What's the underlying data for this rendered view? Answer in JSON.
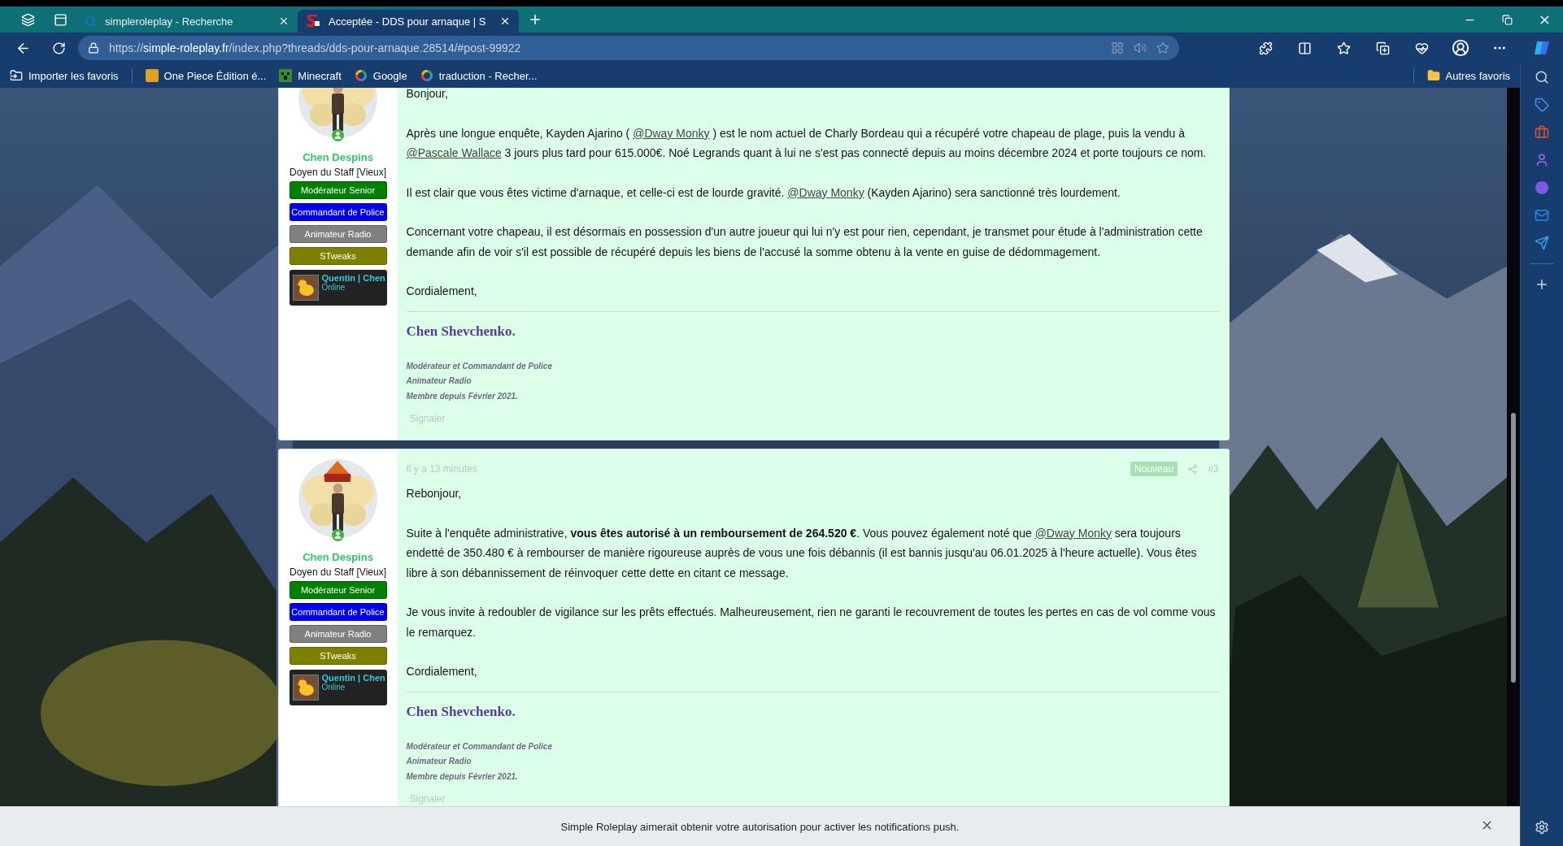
{
  "browser": {
    "tabs": [
      {
        "title": "simpleroleplay - Recherche",
        "kind": "search",
        "selected": false
      },
      {
        "title": "Acceptée - DDS pour arnaque | S",
        "kind": "site",
        "selected": true
      }
    ],
    "address": {
      "scheme": "https://",
      "host": "simple-roleplay.fr",
      "path": "/index.php?threads/dds-pour-arnaque.28514/#post-99922"
    },
    "bookmarks": [
      {
        "label": "Importer les favoris",
        "kind": "import"
      },
      {
        "label": "One Piece Édition é...",
        "kind": "shop"
      },
      {
        "label": "Minecraft",
        "kind": "minecraft"
      },
      {
        "label": "Google",
        "kind": "google"
      },
      {
        "label": "traduction - Recher...",
        "kind": "google"
      }
    ],
    "other_bookmarks": "Autres favoris"
  },
  "posts": [
    {
      "author": {
        "name": "Chen Despins",
        "title": "Doyen du Staff [Vieux]",
        "badges": [
          {
            "label": "Modérateur Senior",
            "color": "#008000"
          },
          {
            "label": "Commandant de Police",
            "color": "#0000ee"
          },
          {
            "label": "Animateur Radio",
            "color": "#808080"
          },
          {
            "label": "STweaks",
            "color": "#808000"
          }
        ],
        "game_card": {
          "name": "Quentin | Chen",
          "status": "Online"
        }
      },
      "paragraphs": [
        [
          {
            "kind": "text",
            "text": "Bonjour,"
          }
        ],
        [
          {
            "kind": "text",
            "text": "Après une longue enquête, Kayden Ajarino ( "
          },
          {
            "kind": "mention",
            "text": "@Dway Monky"
          },
          {
            "kind": "text",
            "text": " ) est le nom actuel de Charly Bordeau qui a récupéré votre chapeau de plage, puis la vendu à "
          },
          {
            "kind": "mention",
            "text": "@Pascale Wallace"
          },
          {
            "kind": "text",
            "text": " 3 jours plus tard pour 615.000€. Noé Legrands quant à lui ne s'est pas connecté depuis au moins décembre 2024 et porte toujours ce nom."
          }
        ],
        [
          {
            "kind": "text",
            "text": "Il est clair que vous êtes victime d'arnaque, et celle-ci est de lourde gravité. "
          },
          {
            "kind": "mention",
            "text": "@Dway Monky"
          },
          {
            "kind": "text",
            "text": " (Kayden Ajarino) sera sanctionné très lourdement."
          }
        ],
        [
          {
            "kind": "text",
            "text": "Concernant votre chapeau, il est désormais en possession d'un autre joueur qui lui n'y est pour rien, cependant, je transmet pour étude à l'administration cette demande afin de voir s'il est possible de récupéré depuis les biens de l'accusé la somme obtenu à la vente en guise de dédommagement."
          }
        ],
        [
          {
            "kind": "text",
            "text": "Cordialement,"
          }
        ]
      ],
      "signature": {
        "name": "Chen Shevchenko.",
        "lines": [
          "Modérateur et Commandant de Police",
          "Animateur Radio",
          "Membre depuis Février 2021."
        ]
      },
      "report": "Signaler"
    },
    {
      "author": {
        "name": "Chen Despins",
        "title": "Doyen du Staff [Vieux]",
        "badges": [
          {
            "label": "Modérateur Senior",
            "color": "#008000"
          },
          {
            "label": "Commandant de Police",
            "color": "#0000ee"
          },
          {
            "label": "Animateur Radio",
            "color": "#808080"
          },
          {
            "label": "STweaks",
            "color": "#808000"
          }
        ],
        "game_card": {
          "name": "Quentin | Chen",
          "status": "Online"
        }
      },
      "meta": {
        "time": "Il y a 13 minutes",
        "badge": "Nouveau",
        "number": "#3"
      },
      "paragraphs": [
        [
          {
            "kind": "text",
            "text": "Rebonjour,"
          }
        ],
        [
          {
            "kind": "text",
            "text": "Suite à l'enquête administrative, **vous êtes autorisé à un remboursement de 264.520 €**. Vous pouvez également noté que "
          },
          {
            "kind": "mention",
            "text": "@Dway Monky"
          },
          {
            "kind": "text",
            "text": " sera toujours endetté de 350.480 € à rembourser de manière rigoureuse auprès de vous une fois débannis (il est bannis jusqu'au 06.01.2025 à l'heure actuelle). Vous êtes libre à son débannissement de réinvoquer cette dette en citant ce message."
          }
        ],
        [
          {
            "kind": "text",
            "text": "Je vous invite à redoubler de vigilance sur les prêts effectués. Malheureusement, rien ne garanti le recouvrement de toutes les pertes en cas de vol comme vous le remarquez."
          }
        ],
        [
          {
            "kind": "text",
            "text": "Cordialement,"
          }
        ]
      ],
      "signature": {
        "name": "Chen Shevchenko.",
        "lines": [
          "Modérateur et Commandant de Police",
          "Animateur Radio",
          "Membre depuis Février 2021."
        ]
      },
      "report": "Signaler"
    }
  ],
  "notification": {
    "message": "Simple Roleplay aimerait obtenir votre autorisation pour activer les notifications push."
  }
}
